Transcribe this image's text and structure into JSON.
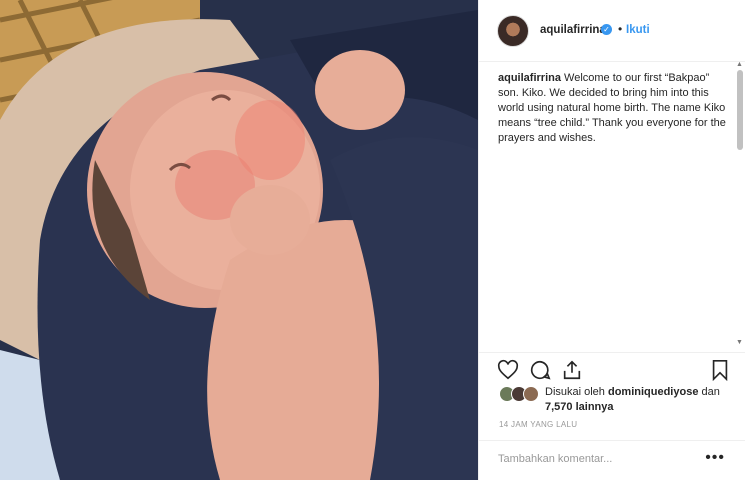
{
  "post": {
    "username": "aquilafirrina",
    "verified_badge": "✓",
    "follow_label": "Ikuti",
    "dot_separator": "•",
    "caption_user": "aquilafirrina",
    "caption_text": " Welcome to our first “Bakpao” son. Kiko. We decided to bring him into this world using natural home birth. The name Kiko means “tree child.” Thank you everyone for the prayers and wishes.",
    "likes_prefix": "Disukai oleh ",
    "likes_user": "dominiquediyose",
    "likes_suffix": " dan",
    "likes_count": "7,570 lainnya",
    "timestamp": "14 JAM YANG LALU",
    "comment_placeholder": "Tambahkan komentar...",
    "more_label": "•••"
  },
  "icons": [
    "heart-icon",
    "comment-icon",
    "share-icon",
    "bookmark-icon",
    "verified-icon"
  ],
  "colors": {
    "link_blue": "#3897f0",
    "text": "#262626",
    "muted": "#999999"
  }
}
